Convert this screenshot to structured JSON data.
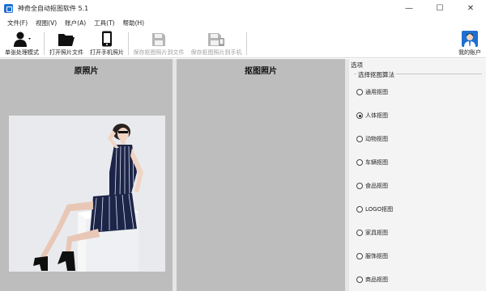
{
  "window": {
    "title": "神奇全自动抠图软件 5.1",
    "controls": {
      "minimize": "—",
      "maximize": "☐",
      "close": "✕"
    }
  },
  "menu": [
    "文件(F)",
    "视图(V)",
    "账户(A)",
    "工具(T)",
    "帮助(H)"
  ],
  "toolbar": {
    "single_mode": "单张处理模式",
    "open_file": "打开照片文件",
    "open_phone": "打开手机照片",
    "save_file": "保存抠图照片到文件",
    "save_phone": "保存抠图照片到手机",
    "account": "我的账户"
  },
  "panels": {
    "original": "原照片",
    "cutout": "抠图照片"
  },
  "options": {
    "header": "选项",
    "group_title": "选择抠图算法",
    "items": [
      {
        "label": "通用抠图",
        "checked": false
      },
      {
        "label": "人体抠图",
        "checked": true
      },
      {
        "label": "动物抠图",
        "checked": false
      },
      {
        "label": "车辆抠图",
        "checked": false
      },
      {
        "label": "食品抠图",
        "checked": false
      },
      {
        "label": "LOGO抠图",
        "checked": false
      },
      {
        "label": "家具抠图",
        "checked": false
      },
      {
        "label": "服饰抠图",
        "checked": false
      },
      {
        "label": "商品抠图",
        "checked": false
      }
    ]
  },
  "colors": {
    "panel_gray": "#bdbdbd",
    "accent_blue": "#1f6fd1"
  }
}
